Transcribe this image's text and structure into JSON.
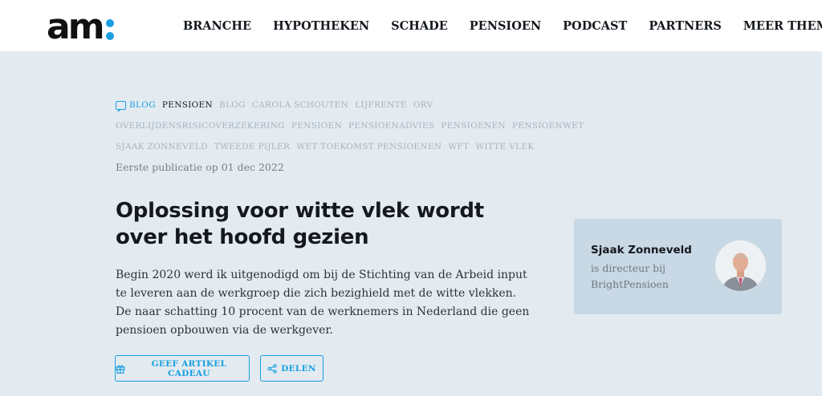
{
  "header": {
    "logo_text": "am",
    "nav": [
      "BRANCHE",
      "HYPOTHEKEN",
      "SCHADE",
      "PENSIOEN",
      "PODCAST",
      "PARTNERS",
      "MEER THEMA'S..."
    ]
  },
  "article": {
    "type_label": "BLOG",
    "active_tag": "PENSIOEN",
    "tags_row1": [
      "BLOG",
      "CAROLA SCHOUTEN",
      "LIJFRENTE",
      "ORV"
    ],
    "tags_row2": [
      "OVERLIJDENSRISICOVERZEKERING",
      "PENSIOEN",
      "PENSIOENADVIES",
      "PENSIOENEN",
      "PENSIOENWET"
    ],
    "tags_row3": [
      "SJAAK ZONNEVELD",
      "TWEEDE PIJLER",
      "WET TOEKOMST PENSIOENEN",
      "WFT",
      "WITTE VLEK"
    ],
    "pubdate": "Eerste publicatie op 01 dec 2022",
    "title": "Oplossing voor witte vlek wordt over het hoofd gezien",
    "lead": "Begin 2020 werd ik uitgenodigd om bij de Stichting van de Arbeid input te leveren aan de werkgroep die zich bezighield met de witte vlekken. De naar schatting 10 procent van de werknemers in Nederland die geen pensioen opbouwen via de werkgever.",
    "gift_button": "GEEF ARTIKEL CADEAU",
    "share_button": "DELEN"
  },
  "author": {
    "name": "Sjaak Zonneveld",
    "role": "is directeur bij BrightPensioen"
  },
  "colors": {
    "accent": "#1a9fe0",
    "background": "#e3ebf1",
    "card": "#c8d9e5"
  }
}
